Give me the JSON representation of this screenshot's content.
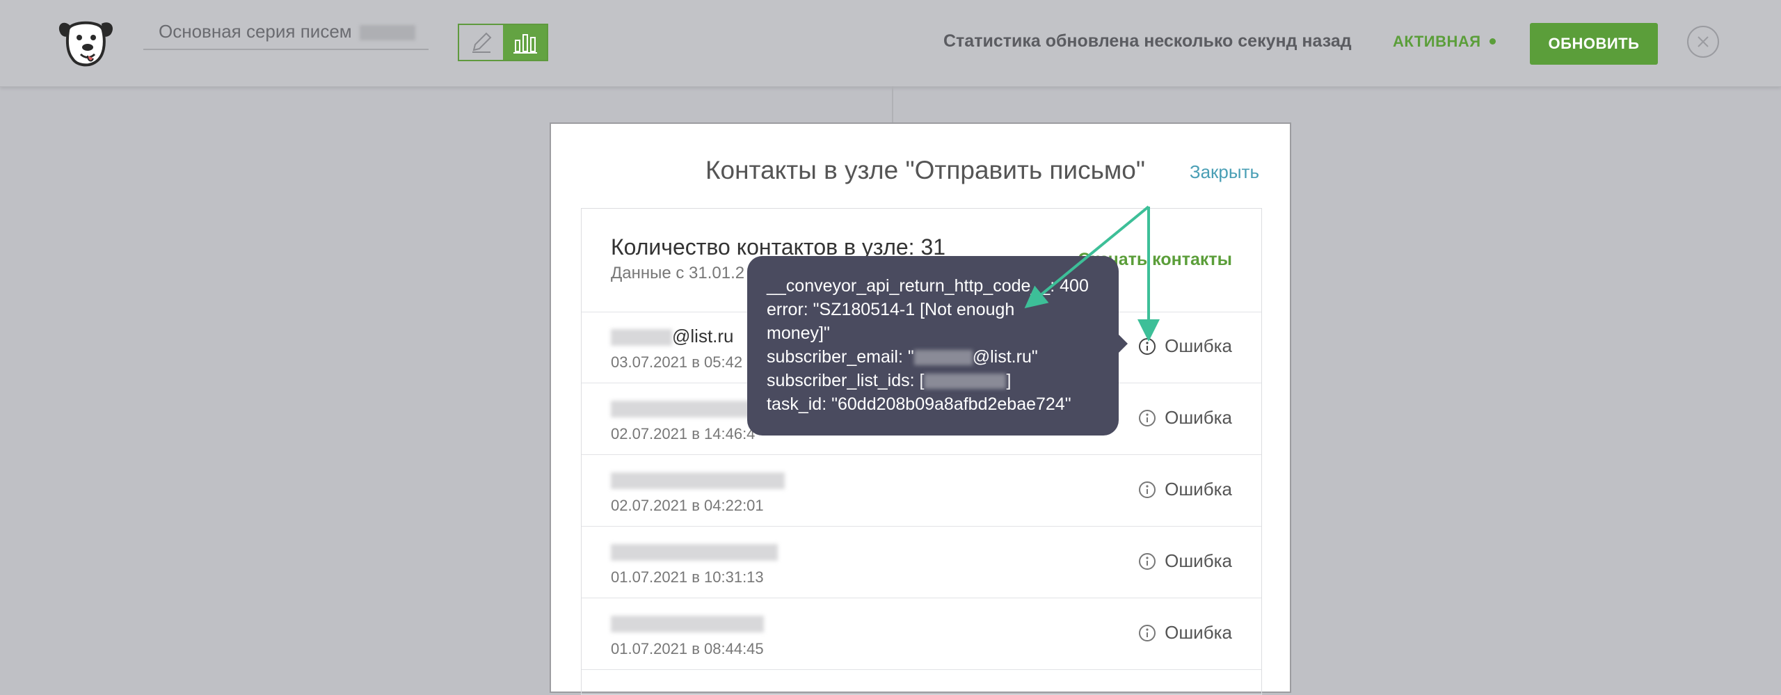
{
  "header": {
    "series_name": "Основная серия писем",
    "stats_text": "Статистика обновлена несколько секунд назад",
    "status_label": "АКТИВНАЯ",
    "refresh_label": "ОБНОВИТЬ"
  },
  "modal": {
    "title": "Контакты в узле \"Отправить письмо\"",
    "close_label": "Закрыть",
    "count_title": "Количество контактов в узле: 31",
    "count_sub": "Данные с 31.01.2",
    "export_label": "Скачать контакты",
    "rows": [
      {
        "email": "@list.ru",
        "date": "03.07.2021 в 05:42",
        "status": "Ошибка"
      },
      {
        "email": "",
        "date": "02.07.2021 в 14:46:4",
        "status": "Ошибка"
      },
      {
        "email": "",
        "date": "02.07.2021 в 04:22:01",
        "status": "Ошибка"
      },
      {
        "email": "",
        "date": "01.07.2021 в 10:31:13",
        "status": "Ошибка"
      },
      {
        "email": "",
        "date": "01.07.2021 в 08:44:45",
        "status": "Ошибка"
      }
    ]
  },
  "tooltip": {
    "line1": "__conveyor_api_return_http_code__: 400",
    "line2": "error: \"SZ180514-1 [Not enough",
    "line3": "money]\"",
    "line4_prefix": "subscriber_email: \"",
    "line4_suffix": "@list.ru\"",
    "line5_prefix": "subscriber_list_ids: [",
    "line5_suffix": "]",
    "line6": "task_id: \"60dd208b09a8afbd2ebae724\""
  },
  "colors": {
    "brand_green": "#5b9e3a",
    "link_blue": "#4a9fb5",
    "tooltip_bg": "#4a4b5f",
    "annotation_arrow": "#3dbf98"
  },
  "icons": [
    "dog-logo-icon",
    "pencil-icon",
    "bar-chart-icon",
    "close-icon",
    "info-icon",
    "download-icon"
  ]
}
